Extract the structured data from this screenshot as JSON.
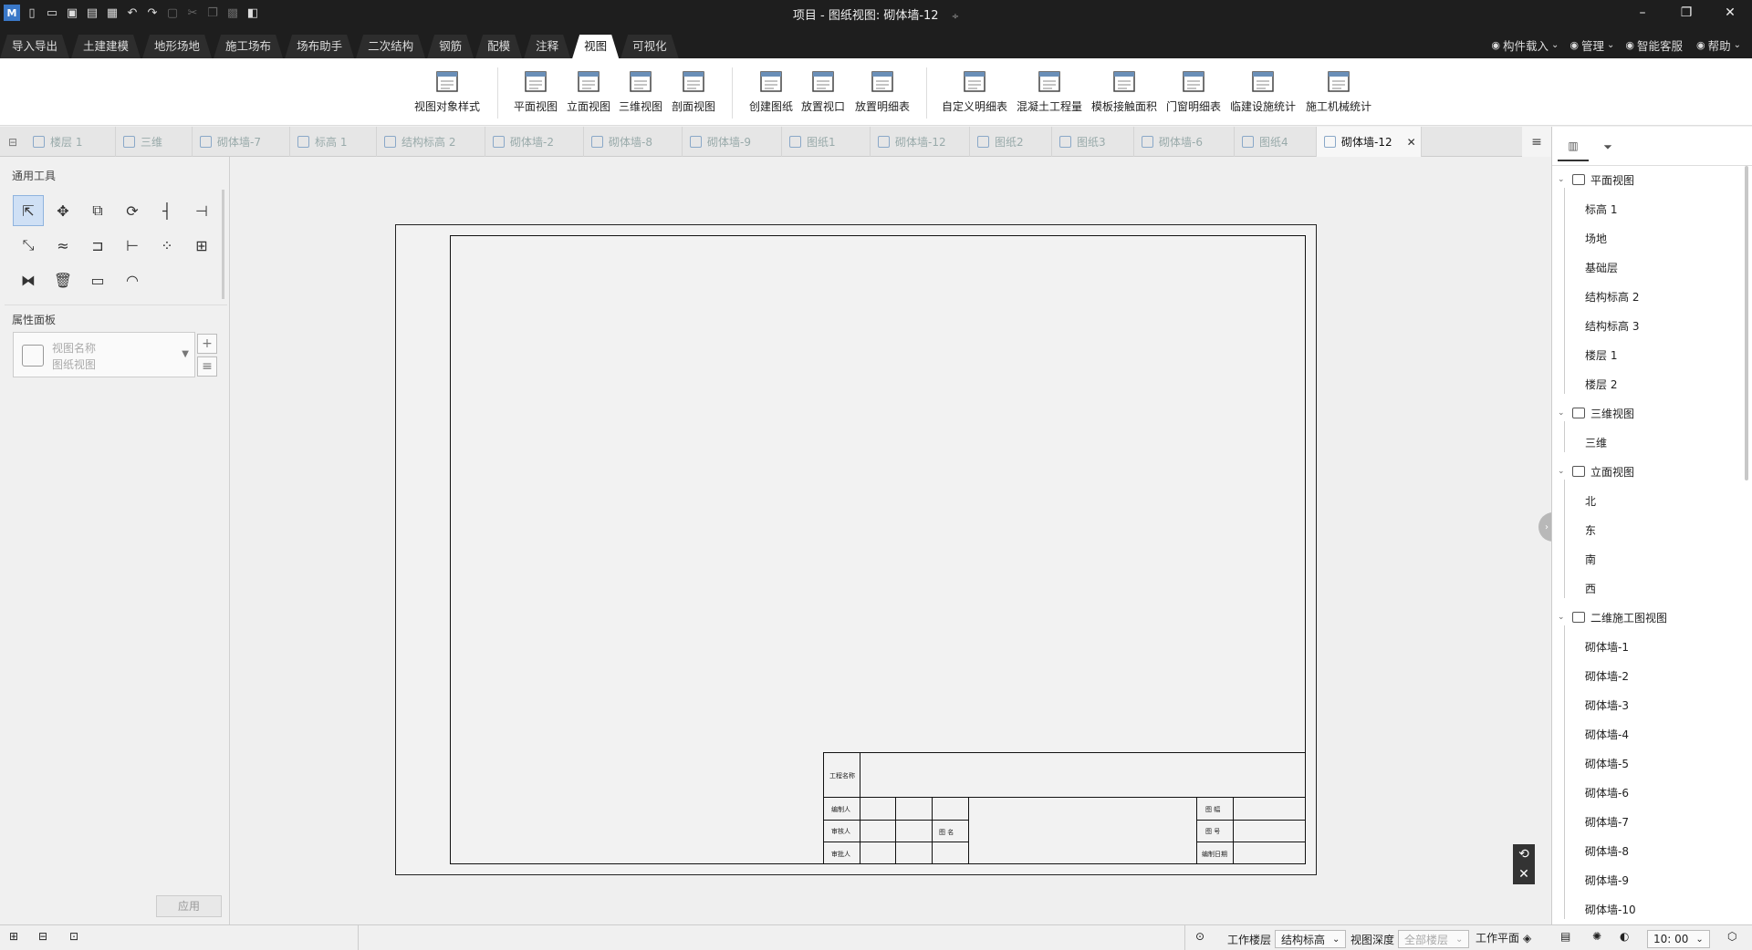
{
  "window": {
    "title": "项目 - 图纸视图: 砌体墙-12",
    "title_marker": "÷",
    "controls": {
      "minimize": "–",
      "restore": "❐",
      "close": "✕"
    }
  },
  "quick_access": [
    "app-logo-icon",
    "new-icon",
    "open-icon",
    "save-icon",
    "save-all-icon",
    "export-icon",
    "undo-icon",
    "redo-icon",
    "select-icon",
    "cut-icon",
    "copy-icon",
    "paste-icon",
    "3d-icon"
  ],
  "menu": {
    "tabs": [
      "导入导出",
      "土建建模",
      "地形场地",
      "施工场布",
      "场布助手",
      "二次结构",
      "钢筋",
      "配模",
      "注释",
      "视图",
      "可视化"
    ],
    "active_index": 9,
    "right": [
      {
        "icon": "component-load-icon",
        "label": "构件载入",
        "caret": "⌄"
      },
      {
        "icon": "manage-icon",
        "label": "管理",
        "caret": "⌄"
      },
      {
        "icon": "service-icon",
        "label": "智能客服",
        "caret": ""
      },
      {
        "icon": "help-icon",
        "label": "帮助",
        "caret": "⌄"
      }
    ]
  },
  "ribbon": {
    "buttons": [
      "视图对象样式",
      "平面视图",
      "立面视图",
      "三维视图",
      "剖面视图",
      "创建图纸",
      "放置视口",
      "放置明细表",
      "自定义明细表",
      "混凝土工程量",
      "模板接触面积",
      "门窗明细表",
      "临建设施统计",
      "施工机械统计"
    ]
  },
  "doc_tabs": {
    "items": [
      "楼层 1",
      "三维",
      "砌体墙-7",
      "标高 1",
      "结构标高 2",
      "砌体墙-2",
      "砌体墙-8",
      "砌体墙-9",
      "图纸1",
      "砌体墙-12",
      "图纸2",
      "图纸3",
      "砌体墙-6",
      "图纸4",
      "砌体墙-12"
    ],
    "active_index": 14,
    "close_glyph": "✕",
    "menu_glyph": "≡"
  },
  "left_panel": {
    "tools_title": "通用工具",
    "props_title": "属性面板",
    "prop_name_placeholder": "视图名称",
    "prop_type": "图纸视图",
    "add_glyph": "+",
    "list_glyph": "≡",
    "apply_label": "应用"
  },
  "title_block": {
    "project_name": "工程名称",
    "drawn_by": "编制人",
    "checked_by": "审核人",
    "approved_by": "审批人",
    "drawing_name": "图 名",
    "drawing_scale": "图 幅",
    "drawing_no": "图 号",
    "drawing_date": "编制日期"
  },
  "canvas_overlay": {
    "rotate": "⟲",
    "close": "✕",
    "collapse": "›"
  },
  "right_panel": {
    "tree": [
      {
        "label": "平面视图",
        "icon": "plan-view-icon",
        "children": [
          "标高 1",
          "场地",
          "基础层",
          "结构标高 2",
          "结构标高 3",
          "楼层 1",
          "楼层 2"
        ]
      },
      {
        "label": "三维视图",
        "icon": "3d-view-icon",
        "children": [
          "三维"
        ]
      },
      {
        "label": "立面视图",
        "icon": "elevation-view-icon",
        "children": [
          "北",
          "东",
          "南",
          "西"
        ]
      },
      {
        "label": "二维施工图视图",
        "icon": "2d-drawing-view-icon",
        "children": [
          "砌体墙-1",
          "砌体墙-2",
          "砌体墙-3",
          "砌体墙-4",
          "砌体墙-5",
          "砌体墙-6",
          "砌体墙-7",
          "砌体墙-8",
          "砌体墙-9",
          "砌体墙-10"
        ]
      }
    ]
  },
  "status_bar": {
    "work_floor_label": "工作楼层",
    "work_floor_value": "结构标高",
    "view_depth_label": "视图深度",
    "view_depth_value": "全部楼层",
    "work_plane_label": "工作平面",
    "time_value": "10: 00",
    "caret": "⌄"
  },
  "colors": {
    "titlebar": "#1e1e1e",
    "accent_select": "#cfe0f5"
  }
}
